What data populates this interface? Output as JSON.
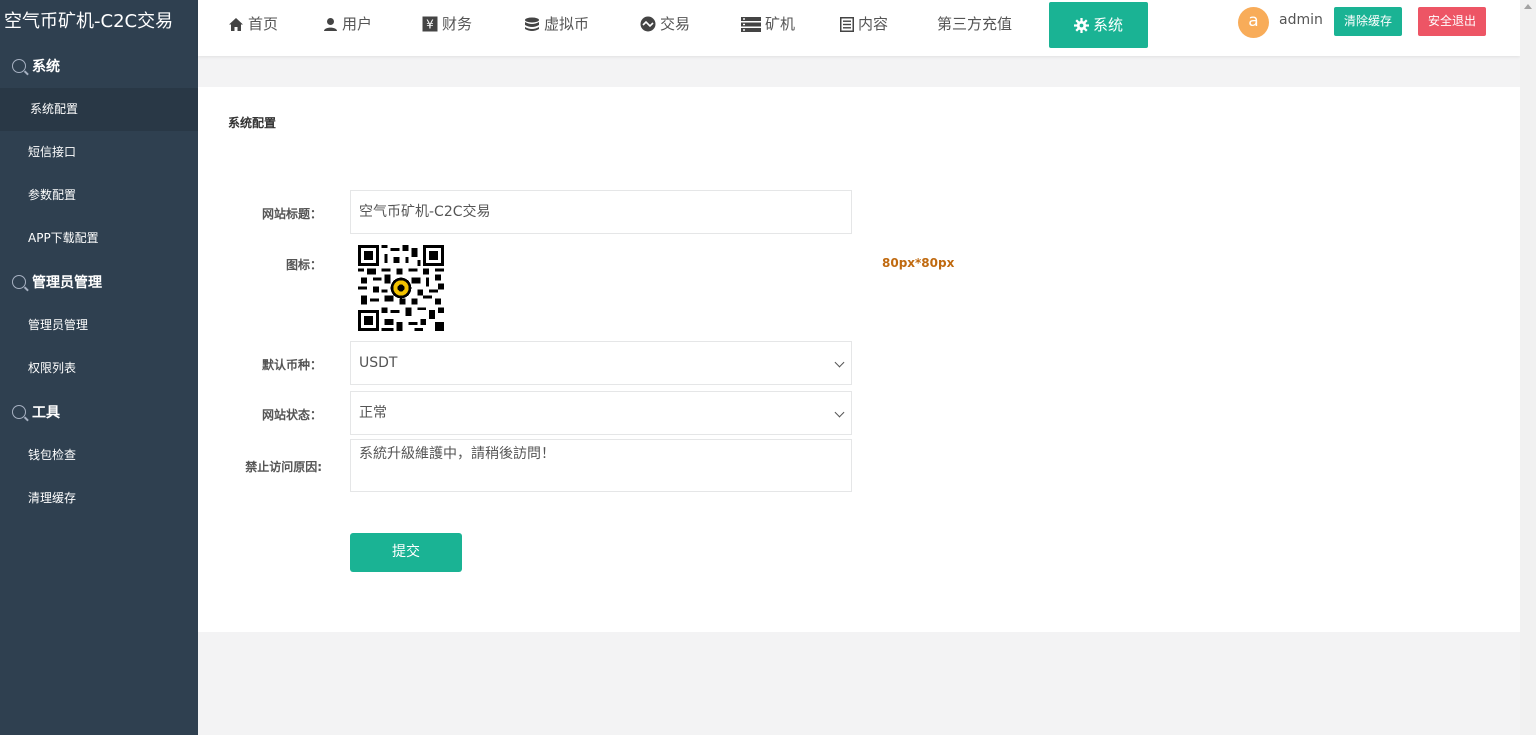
{
  "sidebar": {
    "logo": "空气币矿机-C2C交易",
    "groups": [
      {
        "title": "系统",
        "items": [
          "系统配置",
          "短信接口",
          "参数配置",
          "APP下载配置"
        ]
      },
      {
        "title": "管理员管理",
        "items": [
          "管理员管理",
          "权限列表"
        ]
      },
      {
        "title": "工具",
        "items": [
          "钱包检查",
          "清理缓存"
        ]
      }
    ]
  },
  "nav": {
    "items": [
      {
        "label": "首页",
        "icon": "home-icon"
      },
      {
        "label": "用户",
        "icon": "user-icon"
      },
      {
        "label": "财务",
        "icon": "yen-icon"
      },
      {
        "label": "虚拟币",
        "icon": "database-icon"
      },
      {
        "label": "交易",
        "icon": "exchange-icon"
      },
      {
        "label": "矿机",
        "icon": "server-icon"
      },
      {
        "label": "内容",
        "icon": "list-icon"
      },
      {
        "label": "第三方充值",
        "icon": ""
      },
      {
        "label": "系统",
        "icon": "gear-icon"
      }
    ],
    "active_index": 8
  },
  "user": {
    "avatar_letter": "a",
    "name": "admin",
    "clear_cache": "清除缓存",
    "logout": "安全退出"
  },
  "form": {
    "title": "系统配置",
    "site_title_label": "网站标题：",
    "site_title_value": "空气币矿机-C2C交易",
    "icon_label": "图标：",
    "icon_size_hint": "80px*80px",
    "currency_label": "默认币种：",
    "currency_value": "USDT",
    "status_label": "网站状态：",
    "status_value": "正常",
    "reason_label": "禁止访问原因:",
    "reason_value": "系統升級維護中，請稍後訪問！",
    "submit": "提交"
  },
  "colors": {
    "sidebar_bg": "#2f4050",
    "accent": "#1ab394",
    "danger": "#ed5565",
    "avatar": "#f8ac59",
    "hint": "#c06a10"
  }
}
